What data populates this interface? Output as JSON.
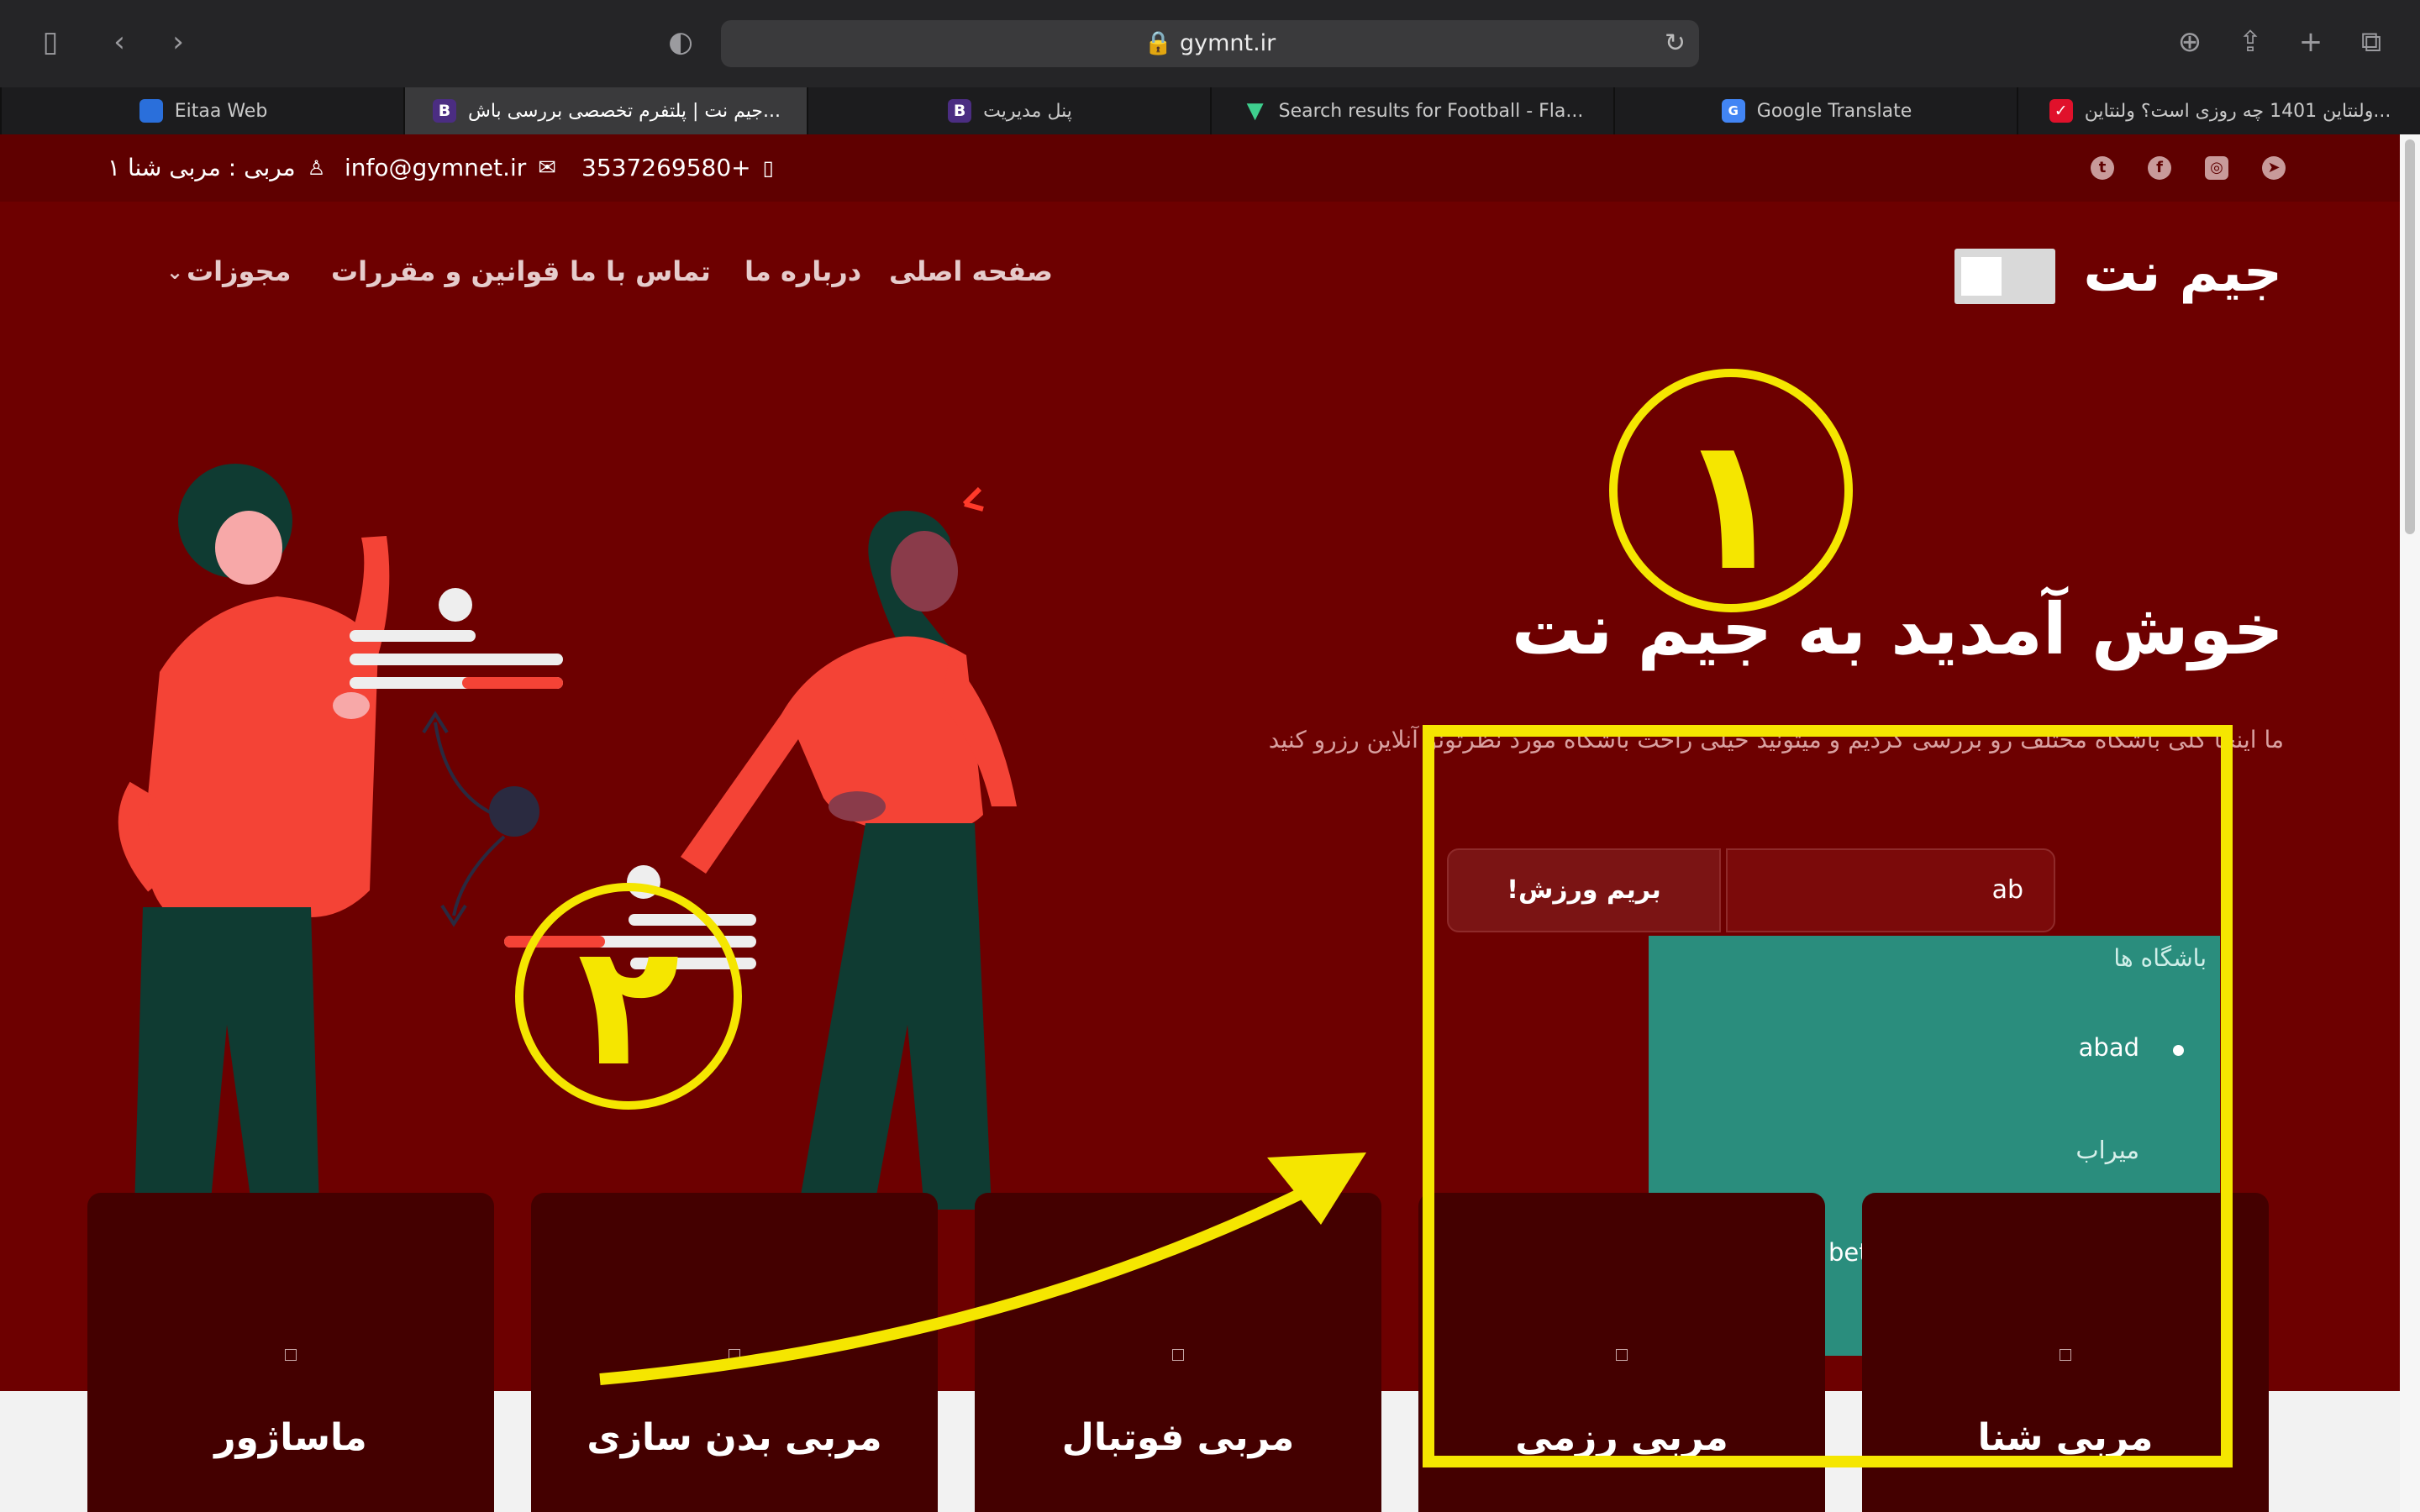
{
  "browser": {
    "url": "gymnt.ir",
    "tabs": [
      {
        "label": "Eitaa Web",
        "favicon": "blue-square-icon"
      },
      {
        "label": "جیم نت | پلتفرم تخصصی بررسی باش...",
        "favicon": "bootstrap-b-icon",
        "active": true
      },
      {
        "label": "پنل مدیریت",
        "favicon": "bootstrap-b-icon"
      },
      {
        "label": "Search results for Football - Fla...",
        "favicon": "green-v-icon"
      },
      {
        "label": "Google Translate",
        "favicon": "google-translate-icon"
      },
      {
        "label": "ولنتاین 1401 چه روزی است؟ ولنتاین...",
        "favicon": "red-check-icon"
      }
    ]
  },
  "topbar": {
    "coach": "مربی : مربی شنا ۱",
    "email": "info@gymnet.ir",
    "phone": "3537269580+"
  },
  "header": {
    "logo": "جیم نت",
    "nav": [
      "صفحه اصلی",
      "درباره ما",
      "تماس با ما",
      "قوانین و مقررات",
      "مجوزات"
    ]
  },
  "hero": {
    "title": "خوش آمدید به جیم نت",
    "description": "ما اینجا کلی باشگاه مختلف رو بررسی کردیم و میتونید خیلی راحت باشگاه مورد نظرتونو آنلاین رزرو کنید"
  },
  "search": {
    "value": "ab",
    "button_label": "!بریم ورزش"
  },
  "dropdown": {
    "header": "باشگاه ها",
    "items": [
      "abad",
      "میراب",
      "bet"
    ]
  },
  "cards": [
    "ماساژور",
    "مربی بدن سازی",
    "مربی فوتبال",
    "مربی رزمی",
    "مربی شنا"
  ],
  "annotations": {
    "mark_1": "۱",
    "mark_2": "۲"
  },
  "colors": {
    "page_bg": "#6d0000",
    "card_bg": "#440000",
    "dropdown_bg": "#2a8d7d",
    "annotation": "#f5e600"
  }
}
